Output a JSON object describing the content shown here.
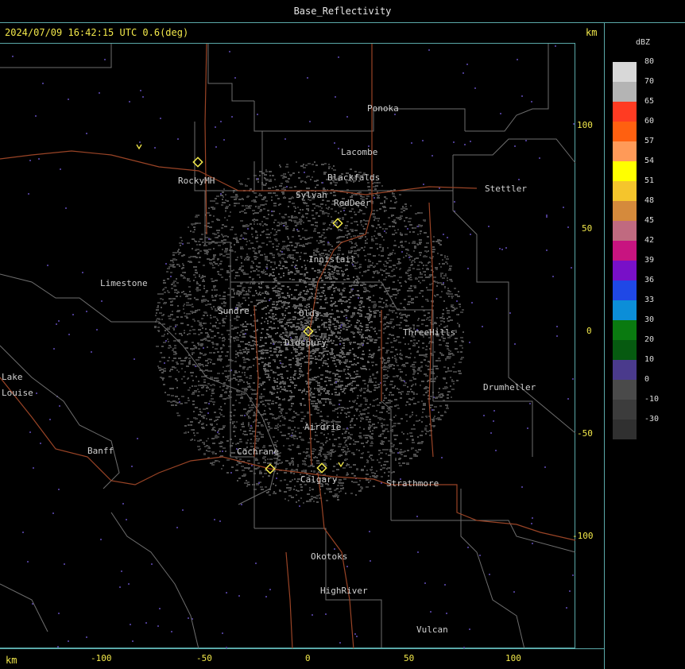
{
  "window": {
    "title": "Base_Reflectivity"
  },
  "header": {
    "timestamp": "2024/07/09 16:42:15 UTC 0.6(deg)",
    "km_label": "km"
  },
  "axes": {
    "x_unit": "km",
    "y_unit": "km",
    "x_ticks": [
      "-100",
      "-50",
      "0",
      "50",
      "100"
    ],
    "y_ticks": [
      "100",
      "50",
      "0",
      "-50",
      "-100"
    ]
  },
  "legend": {
    "title": "dBZ",
    "items": [
      {
        "label": "80",
        "color": "#d8d8d8"
      },
      {
        "label": "70",
        "color": "#b4b4b4"
      },
      {
        "label": "65",
        "color": "#ff3b22"
      },
      {
        "label": "60",
        "color": "#ff6010"
      },
      {
        "label": "57",
        "color": "#ff9a58"
      },
      {
        "label": "54",
        "color": "#ffff00"
      },
      {
        "label": "51",
        "color": "#f5c52c"
      },
      {
        "label": "48",
        "color": "#d58a3c"
      },
      {
        "label": "45",
        "color": "#c06a80"
      },
      {
        "label": "42",
        "color": "#c81480"
      },
      {
        "label": "39",
        "color": "#7810c8"
      },
      {
        "label": "36",
        "color": "#1f48e6"
      },
      {
        "label": "33",
        "color": "#0c8ed8"
      },
      {
        "label": "30",
        "color": "#0a7a10"
      },
      {
        "label": "20",
        "color": "#065a10"
      },
      {
        "label": "10",
        "color": "#4a3a8c"
      },
      {
        "label": "0",
        "color": "#4a4a4a"
      },
      {
        "label": "-10",
        "color": "#3c3c3c"
      },
      {
        "label": "-30",
        "color": "#303030"
      }
    ]
  },
  "cities": [
    "Ponoka",
    "Lacombe",
    "Blackfalds",
    "Sylvan",
    "RedDeer",
    "Stettler",
    "RockyMH",
    "Innisfail",
    "Limestone",
    "Sundre",
    "Olds",
    "Didsbury",
    "ThreeHills",
    "Drumheller",
    "Lake",
    "Louise",
    "Banff",
    "Cochrane",
    "Airdrie",
    "Calgary",
    "Strathmore",
    "Okotoks",
    "HighRiver",
    "Vulcan"
  ],
  "colors": {
    "frame": "#5aa8a8",
    "axis_text": "#f2e84a",
    "boundary": "#7a7a7a",
    "road": "#a04a2a",
    "echo": "#555555"
  }
}
